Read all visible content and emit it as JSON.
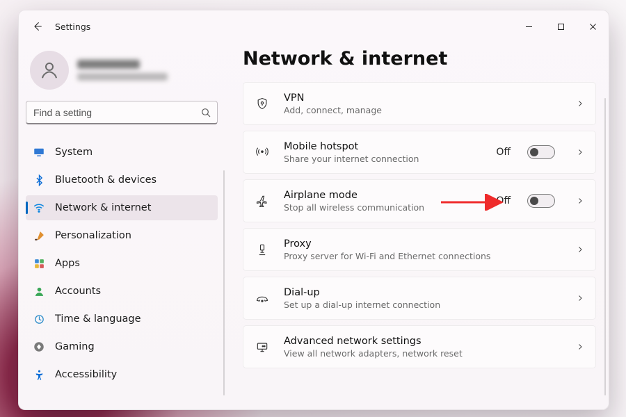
{
  "app": {
    "title": "Settings"
  },
  "profile": {
    "name_blurred": true,
    "email_blurred": true
  },
  "search": {
    "placeholder": "Find a setting"
  },
  "sidebar": {
    "items": [
      {
        "label": "System",
        "icon": "monitor",
        "selected": false
      },
      {
        "label": "Bluetooth & devices",
        "icon": "bluetooth",
        "selected": false
      },
      {
        "label": "Network & internet",
        "icon": "wifi",
        "selected": true
      },
      {
        "label": "Personalization",
        "icon": "brush",
        "selected": false
      },
      {
        "label": "Apps",
        "icon": "apps",
        "selected": false
      },
      {
        "label": "Accounts",
        "icon": "person",
        "selected": false
      },
      {
        "label": "Time & language",
        "icon": "globe-clock",
        "selected": false
      },
      {
        "label": "Gaming",
        "icon": "game",
        "selected": false
      },
      {
        "label": "Accessibility",
        "icon": "accessibility",
        "selected": false
      }
    ]
  },
  "page": {
    "title": "Network & internet",
    "cards": [
      {
        "key": "vpn",
        "title": "VPN",
        "sub": "Add, connect, manage",
        "icon": "shield"
      },
      {
        "key": "hotspot",
        "title": "Mobile hotspot",
        "sub": "Share your internet connection",
        "icon": "hotspot",
        "status": "Off",
        "toggle": false
      },
      {
        "key": "airplane",
        "title": "Airplane mode",
        "sub": "Stop all wireless communication",
        "icon": "airplane",
        "status": "Off",
        "toggle": false,
        "highlighted_arrow": true
      },
      {
        "key": "proxy",
        "title": "Proxy",
        "sub": "Proxy server for Wi-Fi and Ethernet connections",
        "icon": "proxy"
      },
      {
        "key": "dialup",
        "title": "Dial-up",
        "sub": "Set up a dial-up internet connection",
        "icon": "dialup"
      },
      {
        "key": "advanced",
        "title": "Advanced network settings",
        "sub": "View all network adapters, network reset",
        "icon": "advanced"
      }
    ]
  },
  "colors": {
    "accent": "#0067c0",
    "arrow": "#ef2b2b"
  }
}
